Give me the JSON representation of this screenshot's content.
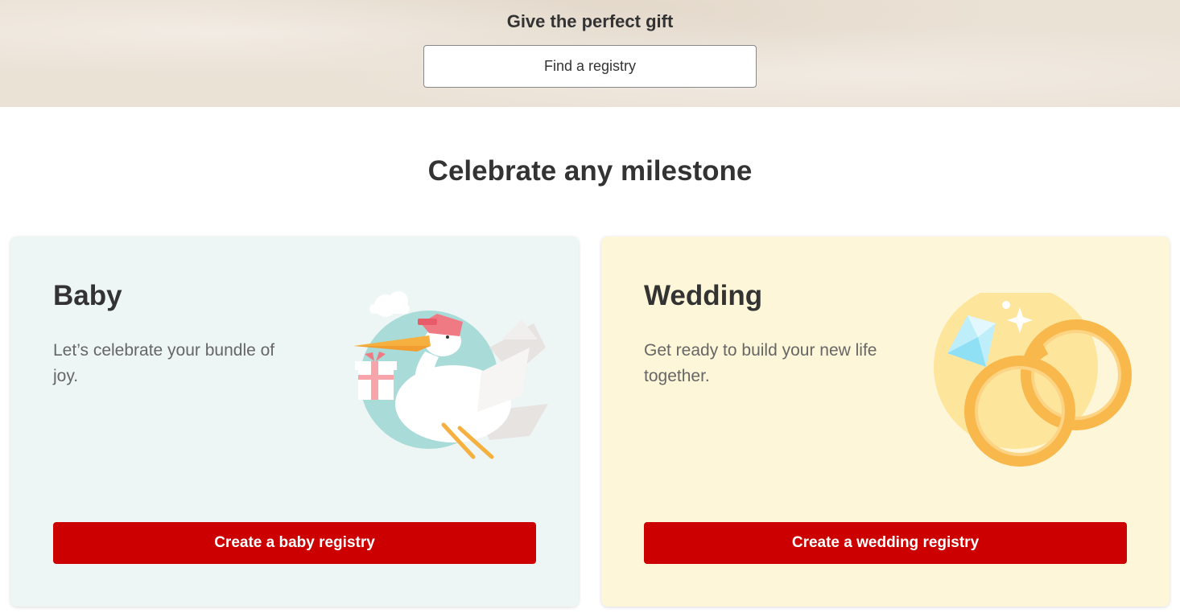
{
  "hero": {
    "title": "Give the perfect gift",
    "find_button_label": "Find a registry"
  },
  "section": {
    "title": "Celebrate any milestone"
  },
  "cards": [
    {
      "title": "Baby",
      "description": "Let’s celebrate your bundle of joy.",
      "button_label": "Create a baby registry",
      "illustration": "stork-carrying-gift-icon",
      "background": "#eef6f5"
    },
    {
      "title": "Wedding",
      "description": "Get ready to build your new life together.",
      "button_label": "Create a wedding registry",
      "illustration": "wedding-rings-diamond-icon",
      "background": "#fdf6d8"
    }
  ],
  "colors": {
    "brand_red": "#cc0000",
    "text_dark": "#333333",
    "text_muted": "#666666",
    "hero_background": "#ebe2d6"
  }
}
